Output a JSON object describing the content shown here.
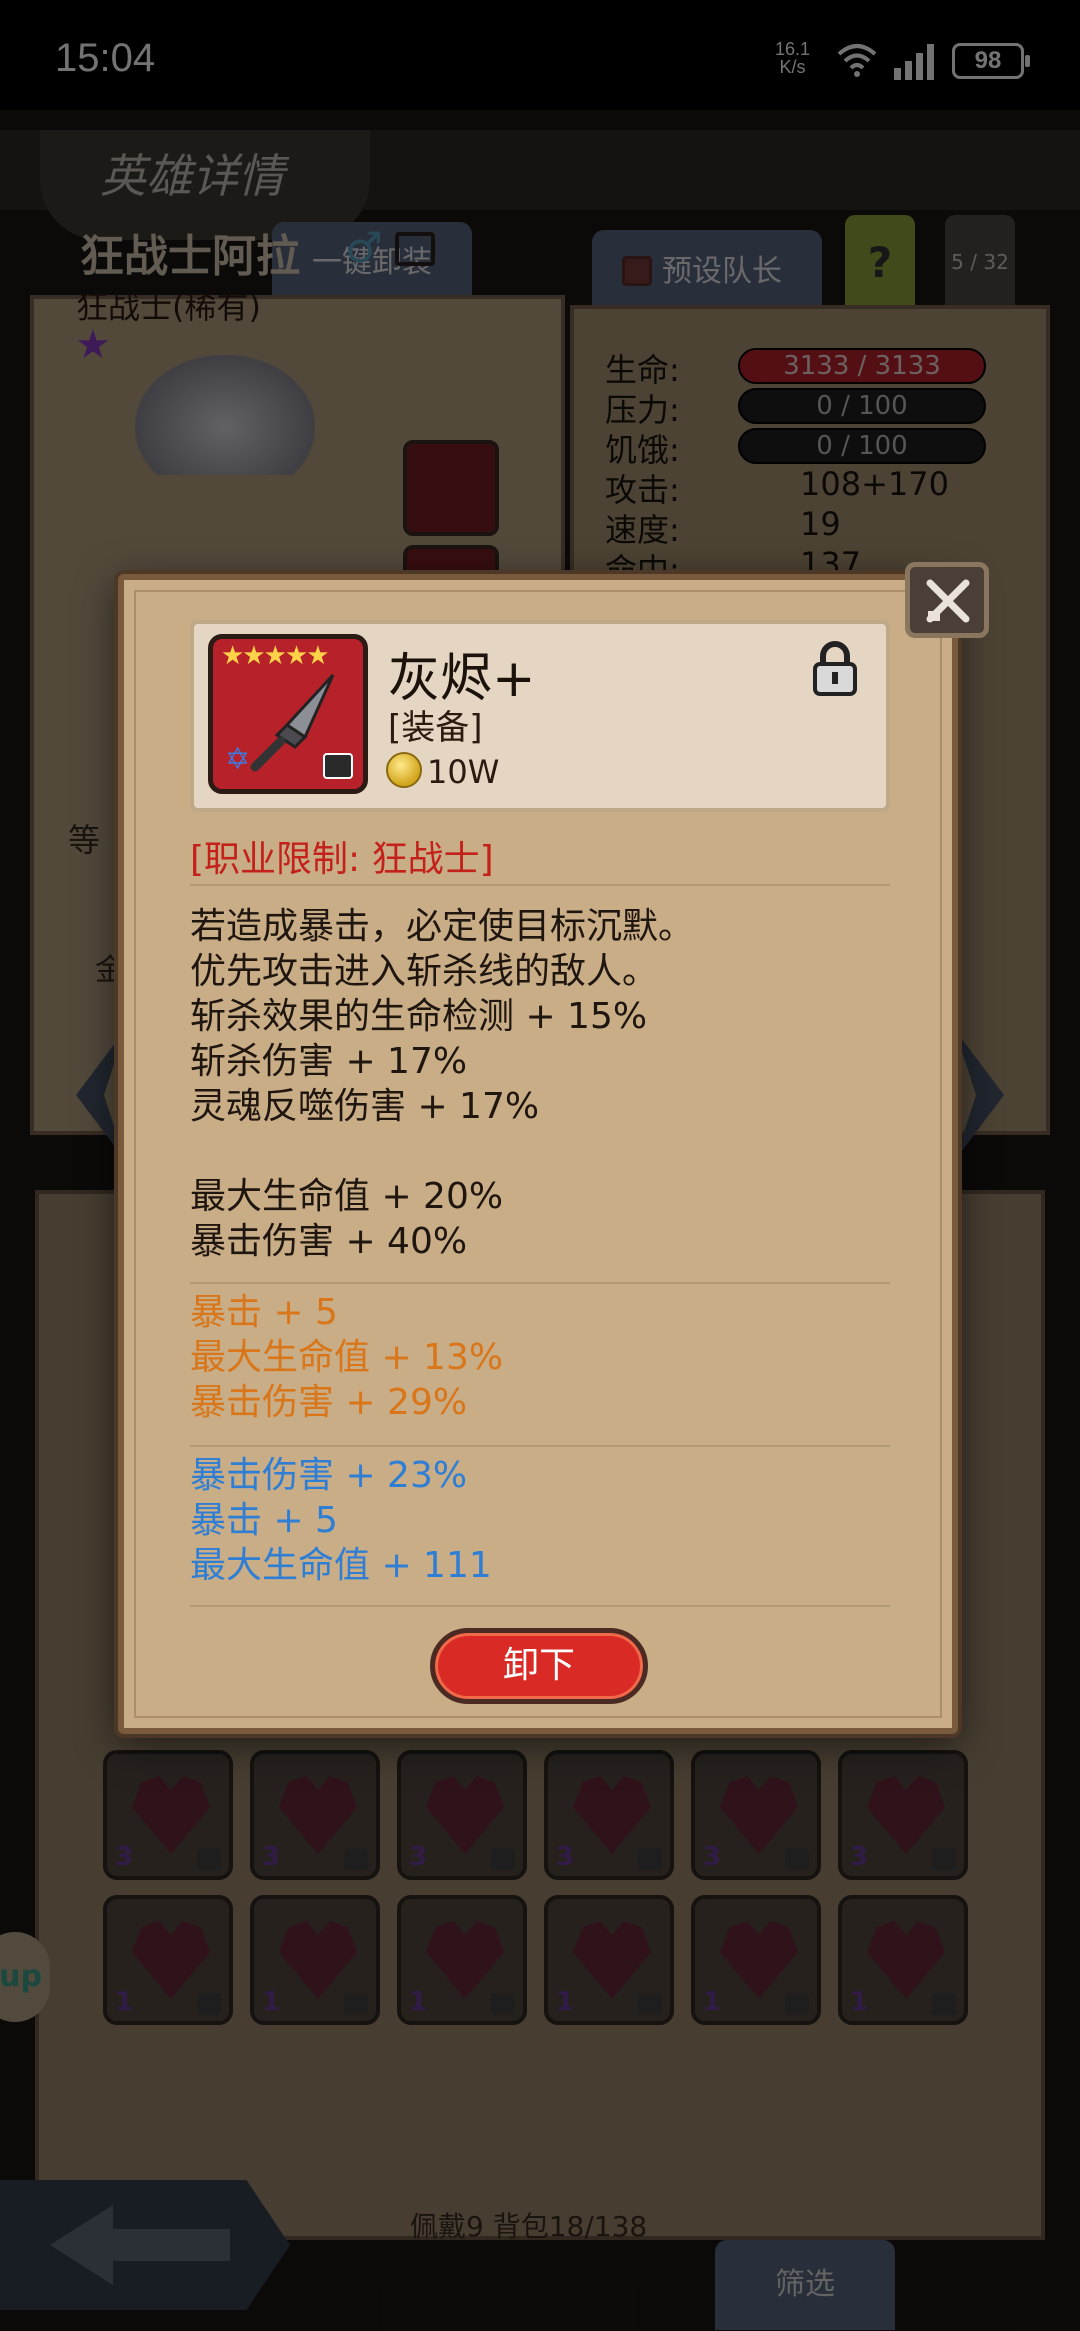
{
  "status_bar": {
    "time": "15:04",
    "net_speed_value": "16.1",
    "net_speed_unit": "K/s",
    "battery": "98"
  },
  "header": {
    "title": "英雄详情",
    "one_click_unequip": "一键卸装",
    "preset_team": "预设队长",
    "help": "?",
    "page": "5 / 32"
  },
  "hero": {
    "name": "狂战士阿拉",
    "class": "狂战士(稀有)",
    "side_label_1": "等",
    "side_label_2": "金"
  },
  "stats": [
    {
      "label": "生命:",
      "value": "3133 / 3133"
    },
    {
      "label": "压力:",
      "value": "0 / 100"
    },
    {
      "label": "饥饿:",
      "value": "0 / 100"
    },
    {
      "label": "攻击:",
      "value": "108+170"
    },
    {
      "label": "速度:",
      "value": "19"
    },
    {
      "label": "命中:",
      "value": "137"
    }
  ],
  "item": {
    "name": "灰烬+",
    "type": "[装备]",
    "price": "10W",
    "stars": "★★★★★",
    "restriction": "[职业限制: 狂战士]",
    "effects": [
      "若造成暴击，必定使目标沉默。",
      "优先攻击进入斩杀线的敌人。",
      "斩杀效果的生命检测 + 15%",
      "斩杀伤害 + 17%",
      "灵魂反噬伤害 + 17%"
    ],
    "base_stats": [
      "最大生命值 + 20%",
      "暴击伤害 + 40%"
    ],
    "orange_stats": [
      "暴击 + 5",
      "最大生命值 + 13%",
      "暴击伤害 + 29%"
    ],
    "blue_stats": [
      "暴击伤害 + 23%",
      "暴击 + 5",
      "最大生命值 + 111"
    ],
    "unequip_label": "卸下"
  },
  "inventory": {
    "row1_counts": [
      "3",
      "3",
      "3",
      "3",
      "3",
      "3"
    ],
    "row2_counts": [
      "1",
      "1",
      "1",
      "1",
      "1",
      "1"
    ],
    "status": "佩戴9 背包18/138",
    "filter_label": "筛选"
  },
  "side_pill_label": "up",
  "colors": {
    "restriction": "#c4211b",
    "orange_stat": "#d9761a",
    "blue_stat": "#2e7ed6",
    "button_red": "#d92a25"
  }
}
